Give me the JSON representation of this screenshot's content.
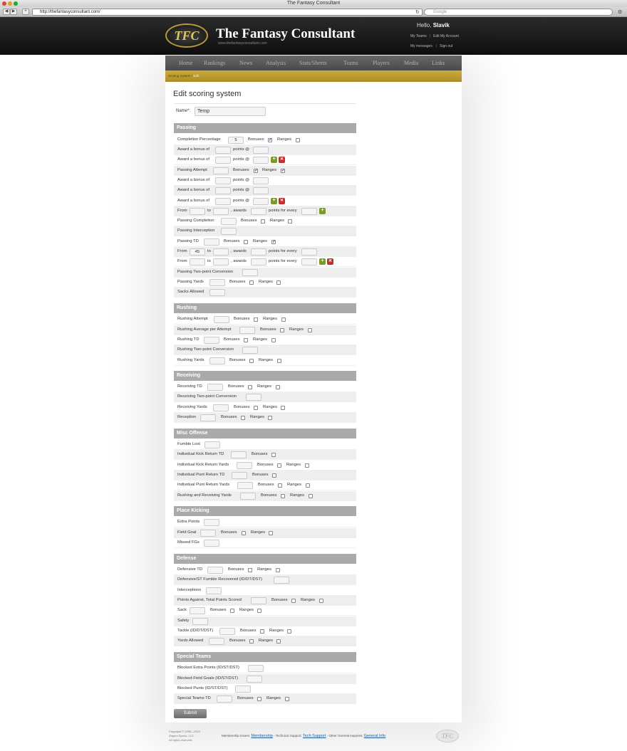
{
  "browser": {
    "title": "The Fantasy Consultant",
    "url": "http://thefantasyconsultant.com/",
    "search_placeholder": "Google"
  },
  "site": {
    "logo_text": "TFC",
    "title": "The Fantasy Consultant",
    "url_text": "www.thefantasyconsultant.com",
    "hello_prefix": "Hello,",
    "username": "Slavik",
    "user_links": [
      "My Teams",
      "Edit My Account",
      "My messages",
      "Sign out"
    ],
    "nav": [
      "Home",
      "Rankings",
      "News",
      "Analysis",
      "Stats/Sheets",
      "Teams",
      "Players",
      "Media",
      "Links"
    ],
    "breadcrumb": {
      "parent": "Scoring System",
      "separator": "/",
      "current": "Edit"
    }
  },
  "form": {
    "title": "Edit scoring system",
    "name_label": "Name*:",
    "name_value": "Temp",
    "submit_label": "Submit"
  },
  "labels": {
    "bonuses": "Bonuses",
    "ranges": "Ranges",
    "award_a_bonus_of": "Award a bonus of",
    "points_at": "points @",
    "from": "From",
    "to": "to",
    "awards": ", awards",
    "points_for_every": "points for every"
  },
  "sections": {
    "passing": "Passing",
    "rushing": "Rushing",
    "receiving": "Receiving",
    "misc_offense": "Misc Offense",
    "place_kicking": "Place Kicking",
    "defense": "Defense",
    "special_teams": "Special Teams"
  },
  "stats": {
    "completion_percentage": "Completion Percentage",
    "completion_percentage_value": "5",
    "passing_attempt": "Passing Attempt",
    "passing_completion": "Passing Completion",
    "passing_interception": "Passing Interception",
    "passing_td": "Passing TD",
    "passing_td_range_from": "45",
    "passing_two_point": "Passing Two-point Conversion",
    "passing_yards": "Passing Yards",
    "sacks_allowed": "Sacks Allowed",
    "rushing_attempt": "Rushing Attempt",
    "rushing_average": "Rushing Average per Attempt",
    "rushing_td": "Rushing TD",
    "rushing_two_point": "Rushing Two-point Conversion",
    "rushing_yards": "Rushing Yards",
    "receiving_td": "Receiving TD",
    "receiving_two_point": "Receiving Two-point Conversion",
    "receiving_yards": "Receiving Yards",
    "reception": "Reception",
    "fumble_lost": "Fumble Lost",
    "kick_return_td": "Individual Kick Return TD",
    "kick_return_yards": "Individual Kick Return Yards",
    "punt_return_td": "Individual Punt Return TD",
    "punt_return_yards": "Individual Punt Return Yards",
    "rush_rec_yards": "Rushing and Receiving Yards",
    "extra_points": "Extra Points",
    "field_goal": "Field Goal",
    "missed_fgs": "Missed FGs",
    "defensive_td": "Defensive TD",
    "def_fumble_recovered": "Defensive/ST Fumble Recovered (ID/DT/DST)",
    "interceptions": "Interceptions",
    "points_against": "Points Against, Total Points Scored",
    "sack": "Sack",
    "safety": "Safety",
    "tackle": "Tackle (ID/DT/DST)",
    "yards_allowed": "Yards Allowed",
    "blocked_extra_points": "Blocked Extra Points (ID/ST/DST)",
    "blocked_field_goals": "Blocked Field Goals (ID/ST/DST)",
    "blocked_punts": "Blocked Punts (ID/ST/DST)",
    "special_teams_td": "Special Teams TD"
  },
  "footer": {
    "copyright": [
      "Copyright © 2009—2010",
      "Zegura Sports, LLC.",
      "All rights reserved."
    ],
    "membership_prefix": "Membership Issues:",
    "membership_link": "Membership",
    "support_prefix": "- Technical Support:",
    "support_link": "Tech Support",
    "general_prefix": "- Other General Inquiries:",
    "general_link": "General Info",
    "logo_text": "TFC"
  }
}
